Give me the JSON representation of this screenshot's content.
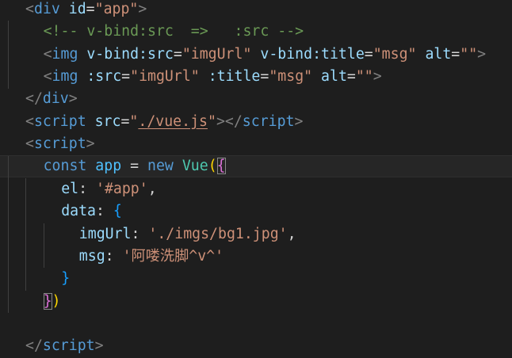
{
  "editor": {
    "language": "html",
    "lines": [
      {
        "indent": 1,
        "tokens": [
          {
            "t": "<",
            "c": "punct"
          },
          {
            "t": "div",
            "c": "tag"
          },
          {
            "t": " ",
            "c": "text"
          },
          {
            "t": "id",
            "c": "attr"
          },
          {
            "t": "=",
            "c": "text"
          },
          {
            "t": "\"app\"",
            "c": "str"
          },
          {
            "t": ">",
            "c": "punct"
          }
        ]
      },
      {
        "indent": 2,
        "tokens": [
          {
            "t": "<!-- v-bind:src  =>   :src -->",
            "c": "comment"
          }
        ]
      },
      {
        "indent": 2,
        "tokens": [
          {
            "t": "<",
            "c": "punct"
          },
          {
            "t": "img",
            "c": "tag"
          },
          {
            "t": " ",
            "c": "text"
          },
          {
            "t": "v-bind:src",
            "c": "attr"
          },
          {
            "t": "=",
            "c": "text"
          },
          {
            "t": "\"imgUrl\"",
            "c": "str"
          },
          {
            "t": " ",
            "c": "text"
          },
          {
            "t": "v-bind:title",
            "c": "attr"
          },
          {
            "t": "=",
            "c": "text"
          },
          {
            "t": "\"msg\"",
            "c": "str"
          },
          {
            "t": " ",
            "c": "text"
          },
          {
            "t": "alt",
            "c": "attr"
          },
          {
            "t": "=",
            "c": "text"
          },
          {
            "t": "\"\"",
            "c": "str"
          },
          {
            "t": ">",
            "c": "punct"
          }
        ]
      },
      {
        "indent": 2,
        "tokens": [
          {
            "t": "<",
            "c": "punct"
          },
          {
            "t": "img",
            "c": "tag"
          },
          {
            "t": " ",
            "c": "text"
          },
          {
            "t": ":src",
            "c": "attr"
          },
          {
            "t": "=",
            "c": "text"
          },
          {
            "t": "\"imgUrl\"",
            "c": "str"
          },
          {
            "t": " ",
            "c": "text"
          },
          {
            "t": ":title",
            "c": "attr"
          },
          {
            "t": "=",
            "c": "text"
          },
          {
            "t": "\"msg\"",
            "c": "str"
          },
          {
            "t": " ",
            "c": "text"
          },
          {
            "t": "alt",
            "c": "attr"
          },
          {
            "t": "=",
            "c": "text"
          },
          {
            "t": "\"\"",
            "c": "str"
          },
          {
            "t": ">",
            "c": "punct"
          }
        ]
      },
      {
        "indent": 1,
        "tokens": [
          {
            "t": "</",
            "c": "punct"
          },
          {
            "t": "div",
            "c": "tag"
          },
          {
            "t": ">",
            "c": "punct"
          }
        ]
      },
      {
        "indent": 1,
        "tokens": [
          {
            "t": "<",
            "c": "punct"
          },
          {
            "t": "script",
            "c": "tag"
          },
          {
            "t": " ",
            "c": "text"
          },
          {
            "t": "src",
            "c": "attr"
          },
          {
            "t": "=",
            "c": "text"
          },
          {
            "t": "\"",
            "c": "str"
          },
          {
            "t": "./vue.js",
            "c": "str",
            "u": true
          },
          {
            "t": "\"",
            "c": "str"
          },
          {
            "t": "></",
            "c": "punct"
          },
          {
            "t": "script",
            "c": "tag"
          },
          {
            "t": ">",
            "c": "punct"
          }
        ]
      },
      {
        "indent": 1,
        "tokens": [
          {
            "t": "<",
            "c": "punct"
          },
          {
            "t": "script",
            "c": "tag"
          },
          {
            "t": ">",
            "c": "punct"
          }
        ]
      },
      {
        "indent": 2,
        "current": true,
        "tokens": [
          {
            "t": "const",
            "c": "kw"
          },
          {
            "t": " ",
            "c": "text"
          },
          {
            "t": "app",
            "c": "var"
          },
          {
            "t": " = ",
            "c": "text"
          },
          {
            "t": "new",
            "c": "kw"
          },
          {
            "t": " ",
            "c": "text"
          },
          {
            "t": "Vue",
            "c": "cls"
          },
          {
            "t": "(",
            "c": "b1"
          },
          {
            "t": "{",
            "c": "b2",
            "m": true
          }
        ]
      },
      {
        "indent": 3,
        "tokens": [
          {
            "t": "el",
            "c": "prop"
          },
          {
            "t": ": ",
            "c": "text"
          },
          {
            "t": "'#app'",
            "c": "str"
          },
          {
            "t": ",",
            "c": "text"
          }
        ]
      },
      {
        "indent": 3,
        "tokens": [
          {
            "t": "data",
            "c": "prop"
          },
          {
            "t": ": ",
            "c": "text"
          },
          {
            "t": "{",
            "c": "b3"
          }
        ]
      },
      {
        "indent": 4,
        "tokens": [
          {
            "t": "imgUrl",
            "c": "prop"
          },
          {
            "t": ": ",
            "c": "text"
          },
          {
            "t": "'./imgs/bg1.jpg'",
            "c": "str"
          },
          {
            "t": ",",
            "c": "text"
          }
        ]
      },
      {
        "indent": 4,
        "tokens": [
          {
            "t": "msg",
            "c": "prop"
          },
          {
            "t": ": ",
            "c": "text"
          },
          {
            "t": "'阿喽洗脚^v^'",
            "c": "str"
          }
        ]
      },
      {
        "indent": 3,
        "tokens": [
          {
            "t": "}",
            "c": "b3"
          }
        ]
      },
      {
        "indent": 2,
        "tokens": [
          {
            "t": "}",
            "c": "b2",
            "m": true
          },
          {
            "t": ")",
            "c": "b1"
          }
        ]
      },
      {
        "indent": 1,
        "tokens": []
      },
      {
        "indent": 1,
        "tokens": [
          {
            "t": "</",
            "c": "punct"
          },
          {
            "t": "script",
            "c": "tag"
          },
          {
            "t": ">",
            "c": "punct"
          }
        ]
      }
    ]
  }
}
